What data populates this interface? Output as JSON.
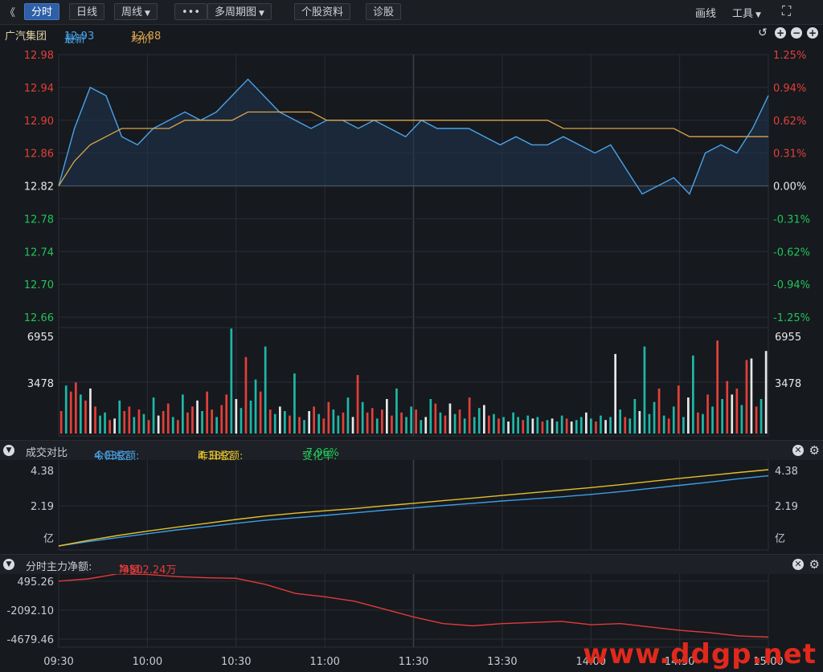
{
  "toolbar": {
    "back_glyph": "《",
    "buttons": [
      "分时",
      "日线",
      "周线",
      "多周期图",
      "个股资料",
      "诊股"
    ],
    "more_glyph": "•••",
    "right_items": [
      "画线",
      "工具"
    ],
    "expand_icon": "expand-icon"
  },
  "info": {
    "stock_name": "广汽集团",
    "latest_label": "最新",
    "latest_value": "12.93",
    "avg_label": "均价",
    "avg_value": "12.88"
  },
  "compare_panel": {
    "title": "成交对比",
    "today_label": "今日总额:",
    "today_value": "4.03亿",
    "yesterday_label": "昨日总额:",
    "yesterday_value": "4.38亿",
    "change_label": "变化率:",
    "change_value": "-7.96%"
  },
  "flow_panel": {
    "title": "分时主力净额:",
    "net_label": "净额:",
    "net_value": "-4502.24万"
  },
  "colors": {
    "price_line": "#4aa3e8",
    "avg_line": "#d9a54a",
    "up": "#e2403a",
    "down": "#1fb7a6",
    "neutral": "#e8e8e8",
    "today_line": "#3b9ee8",
    "yesterday_line": "#e3c02a",
    "flow_line": "#e23a3a"
  },
  "chart_data": [
    {
      "type": "line",
      "title": "分时",
      "x": [
        "09:30",
        "09:33",
        "09:36",
        "09:39",
        "09:42",
        "09:45",
        "09:48",
        "09:51",
        "09:54",
        "09:57",
        "10:00",
        "10:06",
        "10:12",
        "10:18",
        "10:24",
        "10:30",
        "10:36",
        "10:42",
        "10:48",
        "10:54",
        "11:00",
        "11:06",
        "11:12",
        "11:18",
        "11:24",
        "11:30",
        "13:06",
        "13:12",
        "13:18",
        "13:24",
        "13:30",
        "13:36",
        "13:42",
        "13:48",
        "13:54",
        "14:00",
        "14:06",
        "14:12",
        "14:18",
        "14:24",
        "14:30",
        "14:36",
        "14:42",
        "14:48",
        "14:54",
        "15:00"
      ],
      "series": [
        {
          "name": "最新",
          "values": [
            12.82,
            12.89,
            12.94,
            12.93,
            12.88,
            12.87,
            12.89,
            12.9,
            12.91,
            12.9,
            12.91,
            12.93,
            12.95,
            12.93,
            12.91,
            12.9,
            12.89,
            12.9,
            12.9,
            12.89,
            12.9,
            12.89,
            12.88,
            12.9,
            12.89,
            12.89,
            12.89,
            12.88,
            12.87,
            12.88,
            12.87,
            12.87,
            12.88,
            12.87,
            12.86,
            12.87,
            12.84,
            12.81,
            12.82,
            12.83,
            12.81,
            12.86,
            12.87,
            12.86,
            12.89,
            12.93
          ]
        },
        {
          "name": "均价",
          "values": [
            12.82,
            12.85,
            12.87,
            12.88,
            12.89,
            12.89,
            12.89,
            12.89,
            12.9,
            12.9,
            12.9,
            12.9,
            12.91,
            12.91,
            12.91,
            12.91,
            12.91,
            12.9,
            12.9,
            12.9,
            12.9,
            12.9,
            12.9,
            12.9,
            12.9,
            12.9,
            12.9,
            12.9,
            12.9,
            12.9,
            12.9,
            12.9,
            12.89,
            12.89,
            12.89,
            12.89,
            12.89,
            12.89,
            12.89,
            12.89,
            12.88,
            12.88,
            12.88,
            12.88,
            12.88,
            12.88
          ]
        }
      ],
      "ylim": [
        12.66,
        12.98
      ],
      "yticks_left": [
        "12.98",
        "12.94",
        "12.90",
        "12.86",
        "12.82",
        "12.78",
        "12.74",
        "12.70",
        "12.66"
      ],
      "yticks_right": [
        "1.25%",
        "0.94%",
        "0.62%",
        "0.31%",
        "0.00%",
        "-0.31%",
        "-0.62%",
        "-0.94%",
        "-1.25%"
      ],
      "base_price": 12.82
    },
    {
      "type": "bar",
      "title": "成交量",
      "ylim": [
        0,
        6955
      ],
      "yticks": [
        "6955",
        "3478"
      ],
      "values": [
        1500,
        3200,
        2800,
        3400,
        2600,
        2200,
        3000,
        1800,
        1200,
        1400,
        900,
        1000,
        2200,
        1500,
        1800,
        1100,
        1600,
        1300,
        900,
        2400,
        1200,
        1500,
        2000,
        1100,
        900,
        2600,
        1400,
        1800,
        2200,
        1500,
        2800,
        1600,
        1100,
        1900,
        2600,
        7000,
        2300,
        1700,
        5100,
        2200,
        3600,
        2800,
        5800,
        1600,
        1300,
        1800,
        1500,
        1200,
        4000,
        1100,
        900,
        1500,
        1800,
        1300,
        1000,
        2100,
        1600,
        1200,
        1400,
        2400,
        1100,
        3900,
        2100,
        1400,
        1700,
        1000,
        1600,
        2300,
        1200,
        3000,
        1400,
        1100,
        1800,
        1600,
        900,
        1100,
        2300,
        2000,
        1400,
        1200,
        2000,
        1300,
        1600,
        1000,
        2400,
        1100,
        1700,
        1900,
        1200,
        1300,
        1000,
        1100,
        800,
        1400,
        1100,
        900,
        1200,
        1000,
        1100,
        800,
        900,
        1000,
        800,
        1200,
        1000,
        800,
        900,
        1100,
        1400,
        1000,
        800,
        1200,
        900,
        1100,
        5300,
        1600,
        1100,
        1000,
        2300,
        1500,
        5800,
        1300,
        2100,
        3000,
        1200,
        1000,
        1800,
        3200,
        1100,
        2400,
        5200,
        1400,
        1300,
        2600,
        1800,
        6200,
        2300,
        3500,
        2600,
        3000,
        1900,
        4900,
        5000,
        1800,
        2300,
        5500
      ],
      "colors": [
        "up",
        "down",
        "up",
        "up",
        "down",
        "up",
        "neutral",
        "up",
        "down",
        "down",
        "up",
        "neutral",
        "down",
        "up",
        "up",
        "down",
        "up",
        "down",
        "up",
        "down",
        "neutral",
        "up",
        "up",
        "down",
        "up",
        "down",
        "up",
        "up",
        "neutral",
        "down",
        "up",
        "up",
        "down",
        "up",
        "up",
        "down",
        "neutral",
        "down",
        "up",
        "down",
        "down",
        "up",
        "down",
        "up",
        "down",
        "neutral",
        "down",
        "up",
        "down",
        "up",
        "down",
        "neutral",
        "up",
        "down",
        "up",
        "up",
        "down",
        "down",
        "up",
        "down",
        "neutral",
        "up",
        "down",
        "up",
        "up",
        "down",
        "up",
        "neutral",
        "up",
        "down",
        "up",
        "down",
        "down",
        "up",
        "down",
        "neutral",
        "down",
        "up",
        "down",
        "up",
        "neutral",
        "down",
        "up",
        "down",
        "up",
        "down",
        "down",
        "neutral",
        "up",
        "down",
        "up",
        "down",
        "neutral",
        "down",
        "down",
        "up",
        "down",
        "neutral",
        "down",
        "up",
        "down",
        "neutral",
        "down",
        "down",
        "up",
        "neutral",
        "down",
        "down",
        "neutral",
        "down",
        "up",
        "down",
        "neutral",
        "down",
        "neutral",
        "down",
        "up",
        "down",
        "down",
        "neutral",
        "down",
        "down",
        "down",
        "up",
        "down",
        "up",
        "down",
        "up",
        "down",
        "neutral",
        "down",
        "up",
        "down",
        "up",
        "down",
        "up",
        "down",
        "up",
        "neutral",
        "up",
        "down",
        "up",
        "neutral",
        "up",
        "down",
        "neutral"
      ],
      "x_labels": [
        "09:30",
        "10:00",
        "10:30",
        "11:00",
        "11:30",
        "13:30",
        "14:00",
        "14:30",
        "15:00"
      ]
    },
    {
      "type": "line",
      "title": "成交对比",
      "ylim": [
        0,
        4.38
      ],
      "yticks": [
        "4.38",
        "2.19",
        "亿"
      ],
      "x": [
        0,
        10,
        20,
        30,
        40,
        50,
        60,
        70,
        80,
        90,
        100,
        110,
        120,
        130,
        140,
        150,
        160,
        170,
        180,
        190,
        200,
        210,
        220,
        230,
        240
      ],
      "series": [
        {
          "name": "今日总额",
          "values": [
            0.0,
            0.25,
            0.48,
            0.7,
            0.92,
            1.1,
            1.3,
            1.48,
            1.62,
            1.75,
            1.9,
            2.05,
            2.18,
            2.32,
            2.45,
            2.58,
            2.7,
            2.82,
            2.96,
            3.12,
            3.3,
            3.48,
            3.66,
            3.86,
            4.03
          ]
        },
        {
          "name": "昨日总额",
          "values": [
            0.0,
            0.32,
            0.6,
            0.85,
            1.08,
            1.3,
            1.52,
            1.72,
            1.88,
            2.02,
            2.15,
            2.3,
            2.45,
            2.6,
            2.75,
            2.9,
            3.05,
            3.2,
            3.35,
            3.52,
            3.7,
            3.88,
            4.05,
            4.22,
            4.38
          ]
        }
      ]
    },
    {
      "type": "line",
      "title": "分时主力净额",
      "ylim": [
        -5400,
        1200
      ],
      "yticks": [
        "495.26",
        "-2092.10",
        "-4679.46"
      ],
      "x": [
        0,
        10,
        20,
        30,
        40,
        50,
        60,
        70,
        80,
        90,
        100,
        110,
        120,
        130,
        140,
        150,
        160,
        170,
        180,
        190,
        200,
        210,
        220,
        230,
        240
      ],
      "values": [
        495,
        700,
        1150,
        1100,
        900,
        800,
        750,
        200,
        -600,
        -900,
        -1300,
        -2000,
        -2700,
        -3300,
        -3500,
        -3300,
        -3200,
        -3100,
        -3400,
        -3300,
        -3600,
        -3900,
        -4100,
        -4400,
        -4500
      ]
    }
  ],
  "watermark": "www.ddgp.net"
}
